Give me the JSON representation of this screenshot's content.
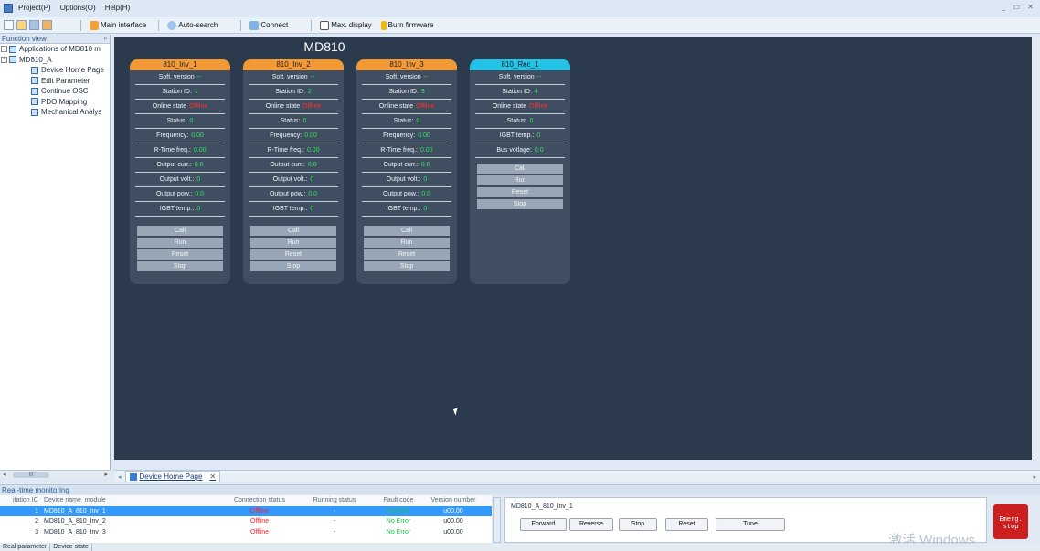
{
  "menu": {
    "items": [
      "Project(P)",
      "Options(O)",
      "Help(H)"
    ],
    "window_controls": "_ ▭ ✕"
  },
  "toolbar": {
    "main_interface": "Main interface",
    "auto_search": "Auto-search",
    "connect": "Connect",
    "max_display": "Max. display",
    "burn_firmware": "Burn firmware"
  },
  "sidebar": {
    "header": "Function view",
    "pin": "ᵖ",
    "items": [
      {
        "label": "Applications of MD810 m"
      },
      {
        "label": "MD810_A"
      },
      {
        "label": "Device Home Page"
      },
      {
        "label": "Edit Parameter"
      },
      {
        "label": "Continue OSC"
      },
      {
        "label": "PDO Mapping"
      },
      {
        "label": "Mechanical Analys"
      }
    ],
    "scroll_left": "◂",
    "scroll_grip": "III",
    "scroll_right": "▸"
  },
  "main": {
    "title": "MD810"
  },
  "cards": [
    {
      "name": "810_Inv_1",
      "header_color": "#f39a37",
      "rows": [
        {
          "label": "Soft. version",
          "value": "--"
        },
        {
          "label": "Station ID:",
          "value": "1"
        },
        {
          "label": "Online state",
          "value": "Offline",
          "red": true
        },
        {
          "label": "Status:",
          "value": "0"
        },
        {
          "label": "Frequency:",
          "value": "0.00"
        },
        {
          "label": "R-Time freq.:",
          "value": "0.00"
        },
        {
          "label": "Output curr.:",
          "value": "0.0"
        },
        {
          "label": "Output volt.:",
          "value": "0"
        },
        {
          "label": "Output pow.:",
          "value": "0.0"
        },
        {
          "label": "IGBT temp.:",
          "value": "0"
        }
      ],
      "buttons": [
        "Call",
        "Run",
        "Reset",
        "Stop"
      ]
    },
    {
      "name": "810_Inv_2",
      "header_color": "#f39a37",
      "rows": [
        {
          "label": "Soft. version",
          "value": "--"
        },
        {
          "label": "Station ID:",
          "value": "2"
        },
        {
          "label": "Online state",
          "value": "Offline",
          "red": true
        },
        {
          "label": "Status:",
          "value": "0"
        },
        {
          "label": "Frequency:",
          "value": "0.00"
        },
        {
          "label": "R-Time freq.:",
          "value": "0.00"
        },
        {
          "label": "Output curr.:",
          "value": "0.0"
        },
        {
          "label": "Output volt.:",
          "value": "0"
        },
        {
          "label": "Output pow.:",
          "value": "0.0"
        },
        {
          "label": "IGBT temp.:",
          "value": "0"
        }
      ],
      "buttons": [
        "Call",
        "Run",
        "Reset",
        "Stop"
      ]
    },
    {
      "name": "810_Inv_3",
      "header_color": "#f39a37",
      "rows": [
        {
          "label": "Soft. version",
          "value": "--"
        },
        {
          "label": "Station ID:",
          "value": "3"
        },
        {
          "label": "Online state",
          "value": "Offline",
          "red": true
        },
        {
          "label": "Status:",
          "value": "0"
        },
        {
          "label": "Frequency:",
          "value": "0.00"
        },
        {
          "label": "R-Time freq.:",
          "value": "0.00"
        },
        {
          "label": "Output curr.:",
          "value": "0.0"
        },
        {
          "label": "Output volt.:",
          "value": "0"
        },
        {
          "label": "Output pow.:",
          "value": "0.0"
        },
        {
          "label": "IGBT temp.:",
          "value": "0"
        }
      ],
      "buttons": [
        "Call",
        "Run",
        "Reset",
        "Stop"
      ]
    },
    {
      "name": "810_Rec_1",
      "header_color": "#22c3e6",
      "rows": [
        {
          "label": "Soft. version",
          "value": "--"
        },
        {
          "label": "Station ID:",
          "value": "4"
        },
        {
          "label": "Online state",
          "value": "Offline",
          "red": true
        },
        {
          "label": "Status:",
          "value": "0"
        },
        {
          "label": "IGBT temp.:",
          "value": "0"
        },
        {
          "label": "Bus votlage:",
          "value": "0.0"
        }
      ],
      "buttons": [
        "Call",
        "Run",
        "Reset",
        "Stop"
      ]
    }
  ],
  "tabbar": {
    "left_arrow": "◂",
    "tab_label": "Device Home Page",
    "close": "✕",
    "right_arrow": "▸"
  },
  "realtime": {
    "header": "Real-time monitoring",
    "columns": [
      "itation IC",
      "Device name_module",
      "Connection status",
      "Running status",
      "Fault code",
      "Version number"
    ],
    "rows": [
      {
        "id": "1",
        "name": "MD810_A_810_Inv_1",
        "conn": "Offline",
        "run": "-",
        "fault": "No Error",
        "ver": "u00.00"
      },
      {
        "id": "2",
        "name": "MD810_A_810_Inv_2",
        "conn": "Offline",
        "run": "-",
        "fault": "No Error",
        "ver": "u00.00"
      },
      {
        "id": "3",
        "name": "MD810_A_810_Inv_3",
        "conn": "Offline",
        "run": "-",
        "fault": "No Error",
        "ver": "u00.00"
      }
    ]
  },
  "control": {
    "device": "MD810_A_810_Inv_1",
    "buttons": [
      "Forward",
      "Reverse",
      "Stop",
      "Reset",
      "Tune"
    ],
    "estop_line1": "Emerg.",
    "estop_line2": "stop"
  },
  "watermark": "激活 Windows",
  "bottom_tabs": [
    "Real parameter",
    "Device state"
  ]
}
